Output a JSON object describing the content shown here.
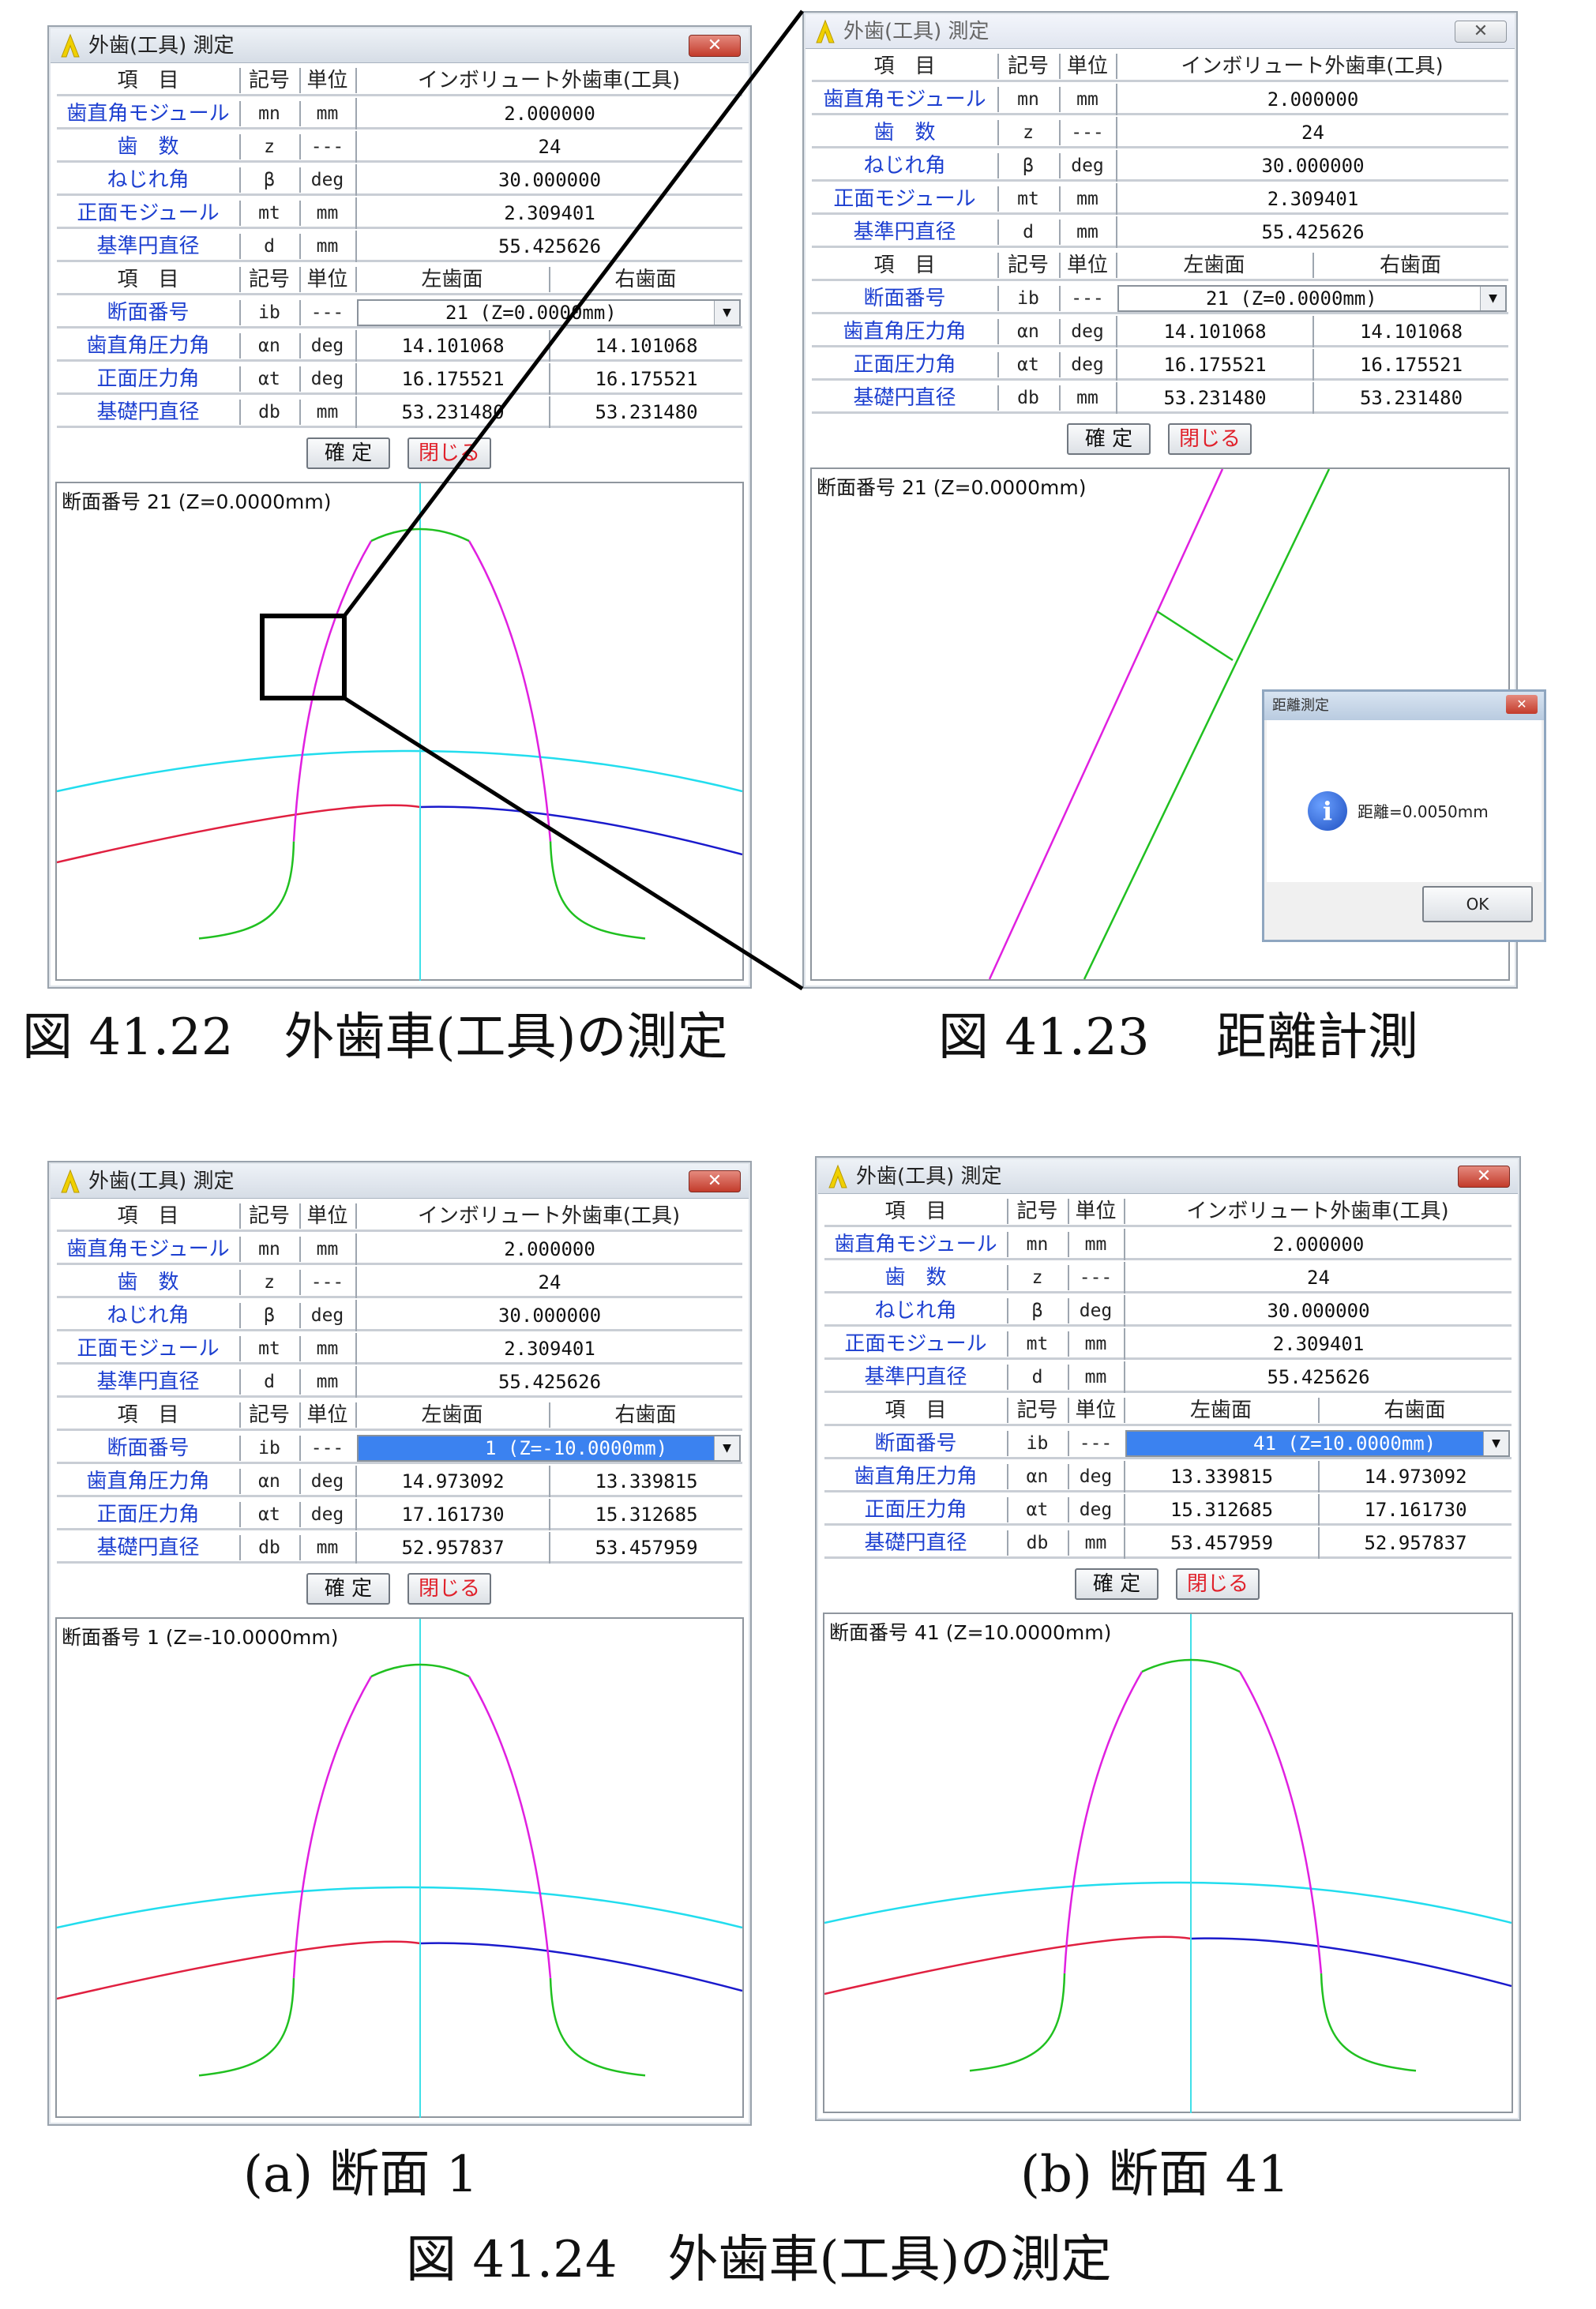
{
  "headers": {
    "item": "項　目",
    "sym": "記号",
    "unit": "単位",
    "tooth": "インボリュート外歯車(工具)",
    "left": "左歯面",
    "right": "右歯面"
  },
  "labels": [
    "歯直角モジュール",
    "歯　数",
    "ねじれ角",
    "正面モジュール",
    "基準円直径",
    "断面番号",
    "歯直角圧力角",
    "正面圧力角",
    "基礎円直径"
  ],
  "syms": [
    "mn",
    "z",
    "β",
    "mt",
    "d",
    "ib",
    "αn",
    "αt",
    "db"
  ],
  "units": [
    "mm",
    "---",
    "deg",
    "mm",
    "mm",
    "---",
    "deg",
    "deg",
    "mm"
  ],
  "common": [
    "2.000000",
    "24",
    "30.000000",
    "2.309401",
    "55.425626"
  ],
  "buttons": {
    "ok": "確 定",
    "close": "閉じる"
  },
  "windows": {
    "w1": {
      "title": "外歯(工具) 測定",
      "section_select": "21  (Z=0.0000mm)",
      "rows": [
        [
          "14.101068",
          "14.101068"
        ],
        [
          "16.175521",
          "16.175521"
        ],
        [
          "53.231480",
          "53.231480"
        ]
      ],
      "section_label": "断面番号 21  (Z=0.0000mm)"
    },
    "w2": {
      "title": "外歯(工具) 測定",
      "section_select": "21  (Z=0.0000mm)",
      "rows": [
        [
          "14.101068",
          "14.101068"
        ],
        [
          "16.175521",
          "16.175521"
        ],
        [
          "53.231480",
          "53.231480"
        ]
      ],
      "section_label": "断面番号 21  (Z=0.0000mm)"
    },
    "w3": {
      "title": "外歯(工具) 測定",
      "section_select": "1  (Z=-10.0000mm)",
      "rows": [
        [
          "14.973092",
          "13.339815"
        ],
        [
          "17.161730",
          "15.312685"
        ],
        [
          "52.957837",
          "53.457959"
        ]
      ],
      "section_label": "断面番号 1  (Z=-10.0000mm)"
    },
    "w4": {
      "title": "外歯(工具) 測定",
      "section_select": "41  (Z=10.0000mm)",
      "rows": [
        [
          "13.339815",
          "14.973092"
        ],
        [
          "15.312685",
          "17.161730"
        ],
        [
          "53.457959",
          "52.957837"
        ]
      ],
      "section_label": "断面番号 41  (Z=10.0000mm)"
    }
  },
  "dialog": {
    "title": "距離測定",
    "message": "距離=0.0050mm",
    "ok": "OK"
  },
  "captions": {
    "fig22": "図 41.22　外歯車(工具)の測定",
    "fig23": "図 41.23　 距離計測",
    "fig24a": "(a)  断面 1",
    "fig24b": "(b)  断面 41",
    "fig24": "図 41.24　外歯車(工具)の測定"
  },
  "colors": {
    "pitch_circle": "#e02040",
    "base_circle": "#1a1acc",
    "tip_circle": "#22ddee",
    "centerline": "#40e0e8",
    "involute": "#e020e0",
    "fillet": "#20c020"
  }
}
